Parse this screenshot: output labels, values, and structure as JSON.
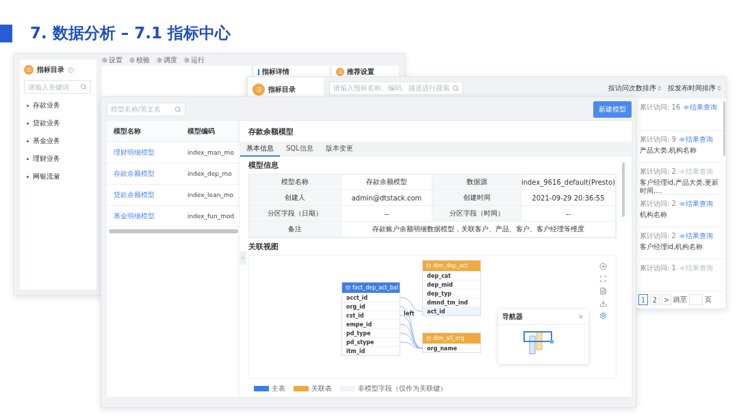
{
  "slide_title": "7. 数据分析 – 7.1 指标中心",
  "catalog_window": {
    "sidebar": {
      "title": "指标目录",
      "search": {
        "placeholder": "请输入关键词"
      },
      "items": [
        "存款业务",
        "贷款业务",
        "基金业务",
        "理财业务",
        "网银流量"
      ]
    },
    "toolbar": [
      "设置",
      "校验",
      "调度",
      "运行"
    ],
    "detail_title": "指标详情",
    "settings_title": "推荐设置"
  },
  "browse_window": {
    "catalog_title": "指标目录",
    "search": {
      "placeholder": "请输入指标名称、编码、描述进行搜索"
    },
    "sort_options": [
      "按访问次数排序",
      "按发布时间排序"
    ],
    "results": [
      {
        "visits": "累计访问: 16",
        "link": "结果查询",
        "link_disabled": false
      },
      {
        "visits": "累计访问: 9",
        "link": "结果查询",
        "link_disabled": false,
        "description": "产品大类,机构名称"
      },
      {
        "visits": "累计访问: 2",
        "link": "结果查询",
        "link_disabled": true,
        "description": "客户经理id,产品大类,更新时间,..."
      },
      {
        "visits": "累计访问: 2",
        "link": "结果查询",
        "link_disabled": false,
        "description": "机构名称"
      },
      {
        "visits": "累计访问: 2",
        "link": "结果查询",
        "link_disabled": false,
        "description": "客户经理id,机构名称"
      },
      {
        "visits": "累计访问: 1",
        "link": "结果查询",
        "link_disabled": true
      }
    ],
    "pagination": {
      "pages": [
        {
          "label": "1",
          "selected": true
        },
        {
          "label": "2",
          "selected": false
        }
      ],
      "next": ">",
      "jump_label": "跳至",
      "page_suffix": "页"
    }
  },
  "model_window": {
    "search": {
      "placeholder": "模型名称/英文名"
    },
    "new_button": "新建模型",
    "columns": [
      "模型名称",
      "模型编码"
    ],
    "rows": [
      {
        "name": "理财明细模型",
        "code": "index_man_mo"
      },
      {
        "name": "存款余额模型",
        "code": "index_dep_mo"
      },
      {
        "name": "贷款余额模型",
        "code": "index_loan_mo"
      },
      {
        "name": "基金明细模型",
        "code": "index_fun_mod"
      }
    ],
    "detail": {
      "title": "存款余额模型",
      "tabs": [
        {
          "label": "基本信息",
          "selected": true
        },
        {
          "label": "SQL信息",
          "selected": false
        },
        {
          "label": "版本变更",
          "selected": false
        }
      ],
      "info_title": "模型信息",
      "info_rows": [
        [
          {
            "label": "模型名称",
            "value": "存款余额模型"
          },
          {
            "label": "数据源",
            "value": "index_9616_default(Presto)"
          }
        ],
        [
          {
            "label": "创建人",
            "value": "admin@dtstack.com"
          },
          {
            "label": "创建时间",
            "value": "2021-09-29 20:36:55"
          }
        ],
        [
          {
            "label": "分区字段（日期）",
            "value": "--"
          },
          {
            "label": "分区字段（时间）",
            "value": "--"
          }
        ]
      ],
      "remark": {
        "label": "备注",
        "value": "存款账户余额明细数据模型，关联客户、产品、客户、客户经理等维度"
      },
      "view_title": "关联视图",
      "tables": [
        {
          "name": "fact_dep_act_bal",
          "kind": "main",
          "fields": [
            {
              "name": "acct_id",
              "key_only": false
            },
            {
              "name": "org_id",
              "key_only": false
            },
            {
              "name": "cst_id",
              "key_only": false
            },
            {
              "name": "empe_id",
              "key_only": false
            },
            {
              "name": "pd_type",
              "key_only": false
            },
            {
              "name": "pd_stype",
              "key_only": false
            },
            {
              "name": "itm_id",
              "key_only": false
            }
          ]
        },
        {
          "name": "dim_dep_act",
          "kind": "related",
          "fields": [
            {
              "name": "dep_cat",
              "key_only": false
            },
            {
              "name": "dep_mid",
              "key_only": false
            },
            {
              "name": "dep_typ",
              "key_only": false
            },
            {
              "name": "dmnd_tm_ind",
              "key_only": false
            },
            {
              "name": "act_id",
              "key_only": true
            }
          ]
        },
        {
          "name": "dim_all_org",
          "kind": "related",
          "fields": [
            {
              "name": "org_name",
              "key_only": false
            }
          ]
        }
      ],
      "join_label": "left",
      "navigator_title": "导航器",
      "legend": [
        {
          "kind": "main",
          "label": "主表"
        },
        {
          "kind": "related",
          "label": "关联表"
        },
        {
          "kind": "key_only",
          "label": "非模型字段（仅作为关联键）"
        }
      ]
    }
  }
}
